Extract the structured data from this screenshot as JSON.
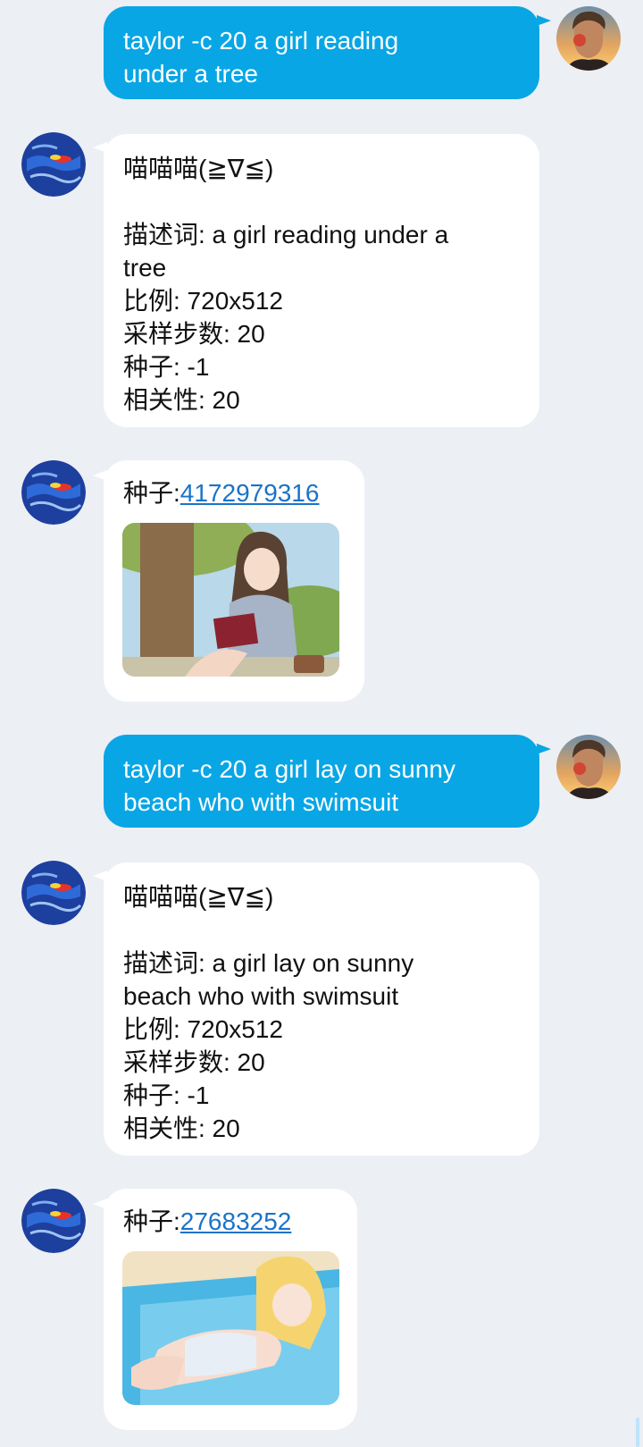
{
  "messages": [
    {
      "id": "m1",
      "direction": "outgoing",
      "lines": [
        "taylor -c 20 a girl reading",
        "under a tree"
      ]
    },
    {
      "id": "m2",
      "direction": "incoming",
      "greeting": "喵喵喵(≧∇≦)",
      "lines": [
        "描述词: a girl reading under a",
        "tree",
        "比例: 720x512",
        "采样步数: 20",
        "种子: -1",
        "相关性: 20"
      ]
    },
    {
      "id": "m3",
      "direction": "incoming",
      "seed_label": "种子:",
      "seed_value": "4172979316",
      "image_alt": "anime girl reading a red book under a tree"
    },
    {
      "id": "m4",
      "direction": "outgoing",
      "lines": [
        "taylor -c 20 a girl lay on sunny",
        "beach who with swimsuit"
      ]
    },
    {
      "id": "m5",
      "direction": "incoming",
      "greeting": "喵喵喵(≧∇≦)",
      "lines": [
        "描述词: a girl lay on sunny",
        "beach who with swimsuit",
        "比例: 720x512",
        "采样步数: 20",
        "种子: -1",
        "相关性: 20"
      ]
    },
    {
      "id": "m6",
      "direction": "incoming",
      "seed_label": "种子:",
      "seed_value": "27683252",
      "image_alt": "anime girl in swimsuit lying on a beach towel"
    }
  ],
  "colors": {
    "background": "#eceff4",
    "outgoing_bubble": "#08a6e5",
    "incoming_bubble": "#ffffff",
    "link": "#1a73c8"
  },
  "icons": {
    "user_avatar": "user-avatar-photo",
    "bot_avatar": "bot-avatar-globe"
  }
}
